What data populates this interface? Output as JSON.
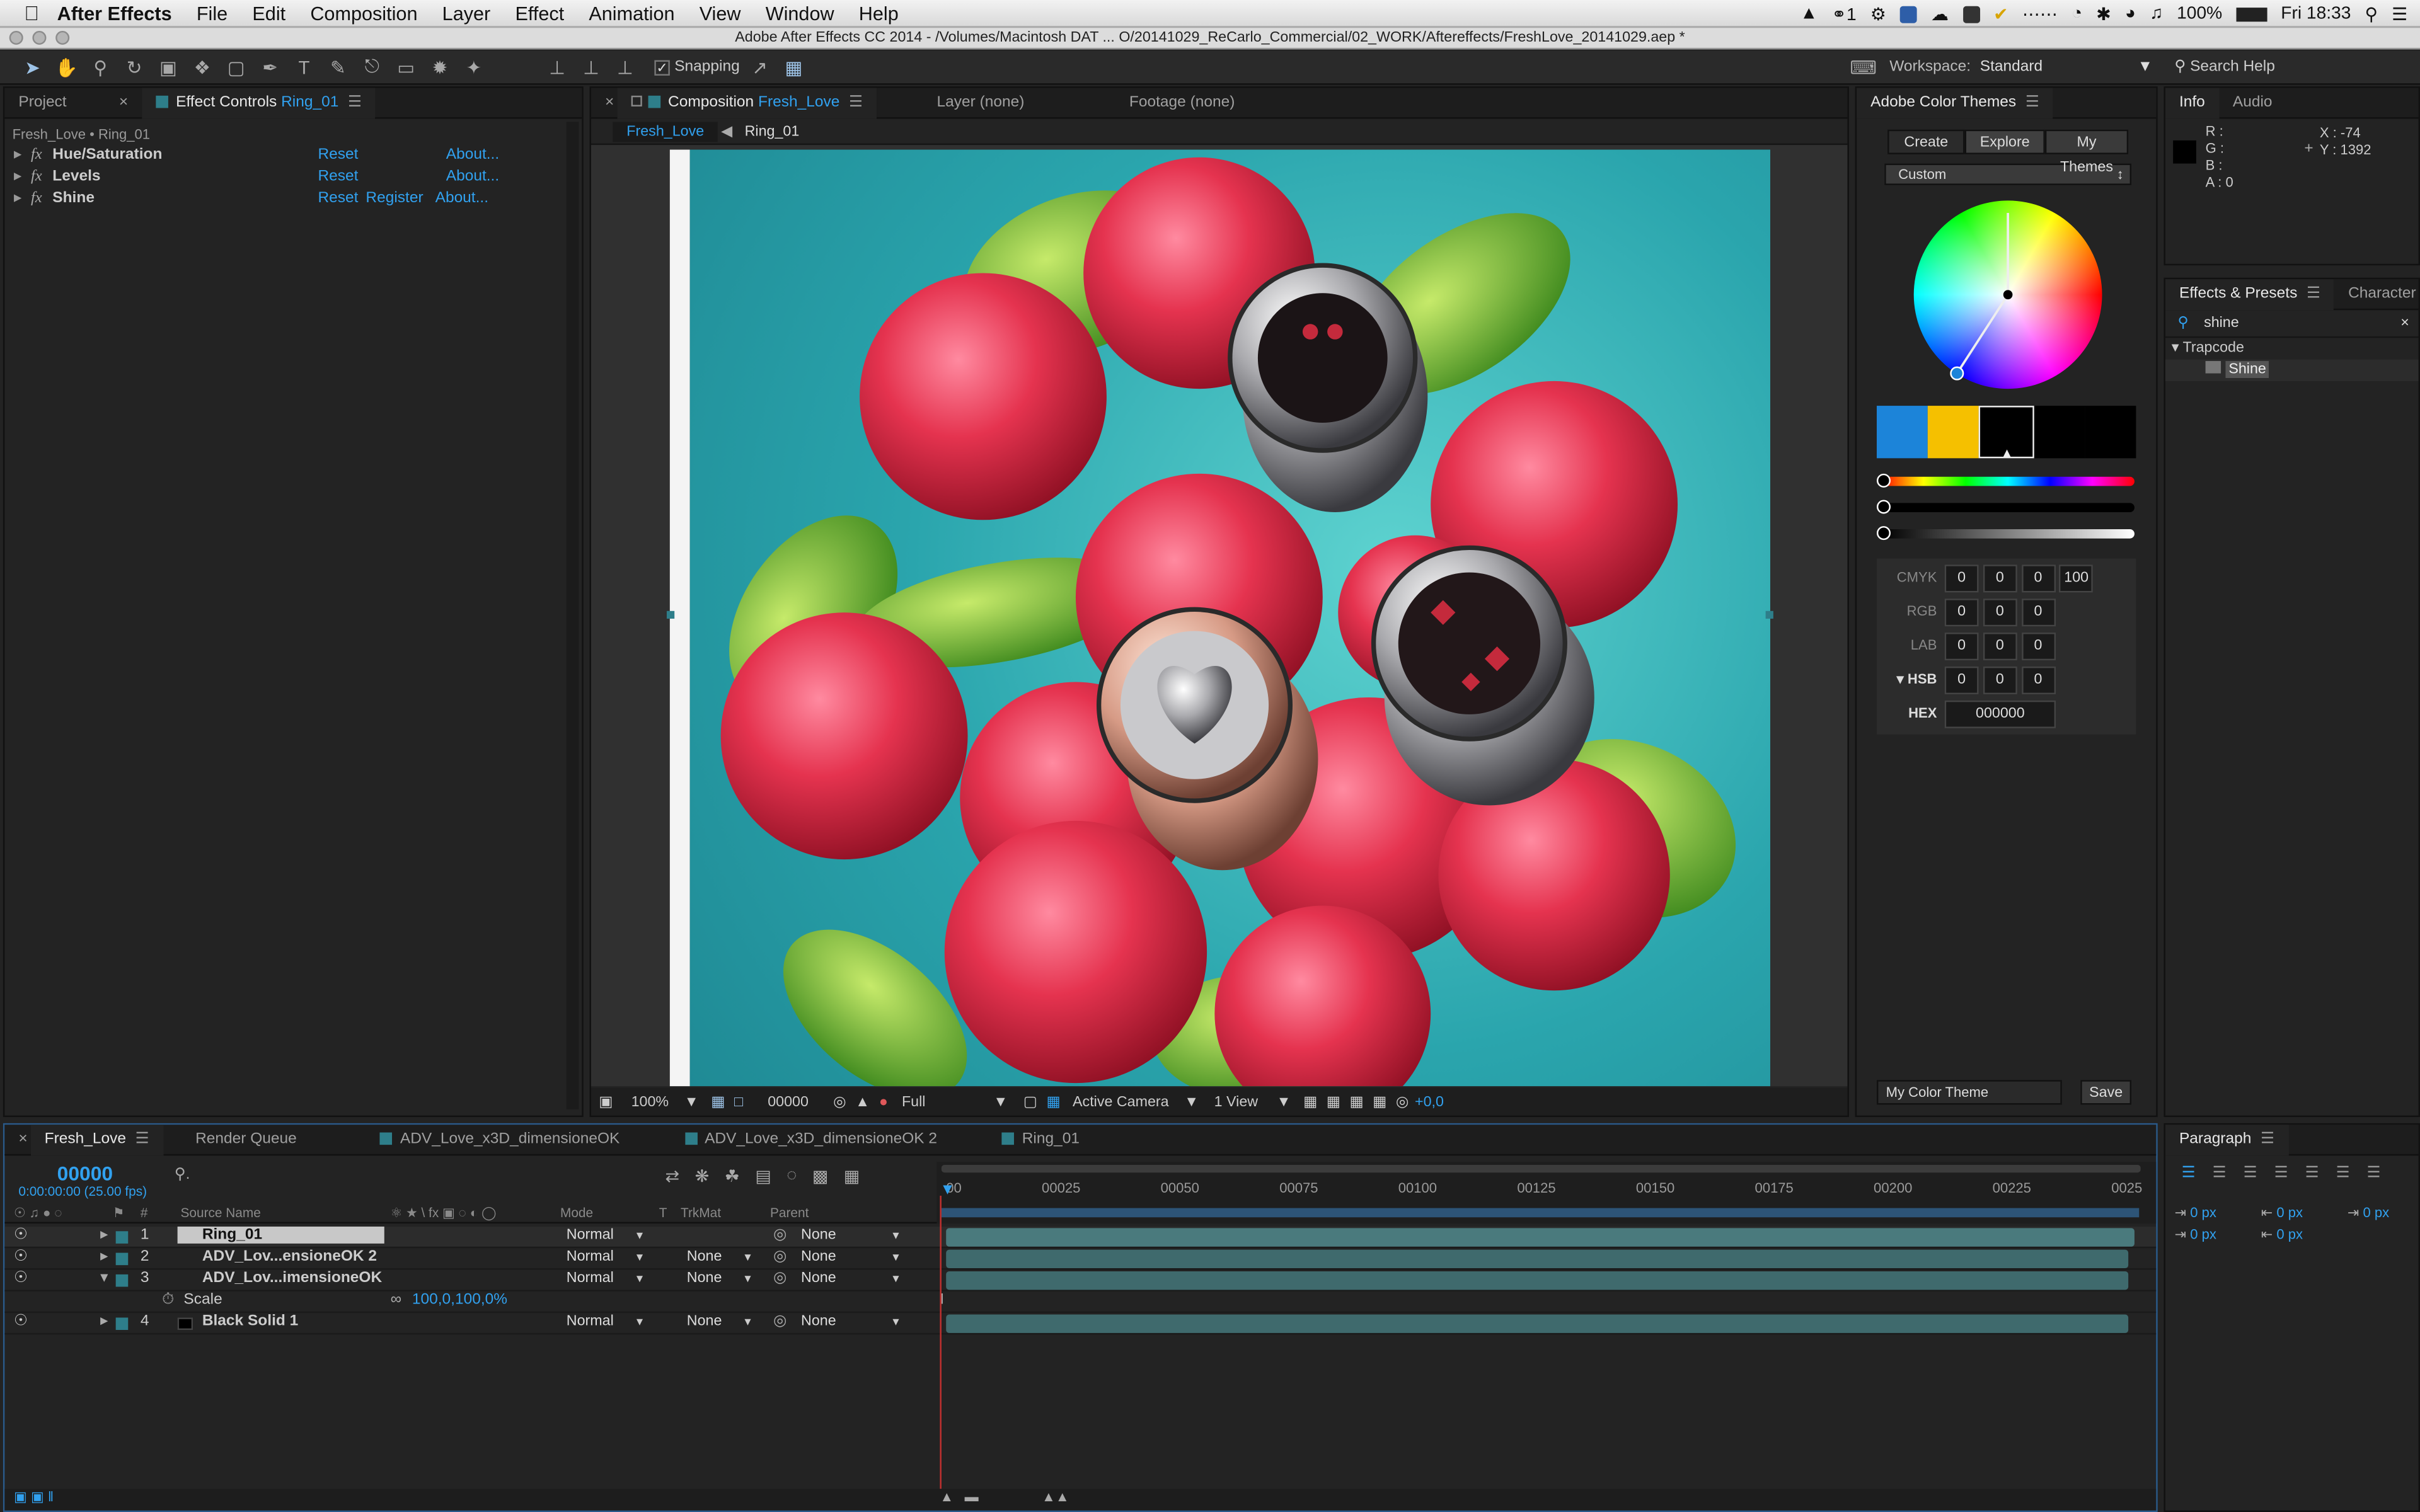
{
  "menubar": {
    "app": "After Effects",
    "items": [
      "File",
      "Edit",
      "Composition",
      "Layer",
      "Effect",
      "Animation",
      "View",
      "Window",
      "Help"
    ],
    "battery": "100%",
    "clock": "Fri 18:33",
    "notification_count": "1"
  },
  "window_title": "Adobe After Effects CC 2014 - /Volumes/Macintosh DAT ... O/20141029_ReCarlo_Commercial/02_WORK/Aftereffects/FreshLove_20141029.aep *",
  "toolbar": {
    "snapping": "Snapping",
    "workspace_label": "Workspace:",
    "workspace_value": "Standard",
    "search": "Search Help"
  },
  "project_panel": {
    "tab_project": "Project",
    "tab_effects": "Effect Controls",
    "layer": "Ring_01",
    "breadcrumb": "Fresh_Love • Ring_01",
    "effects": [
      {
        "name": "Hue/Saturation",
        "reset": "Reset",
        "register": "",
        "about": "About..."
      },
      {
        "name": "Levels",
        "reset": "Reset",
        "register": "",
        "about": "About..."
      },
      {
        "name": "Shine",
        "reset": "Reset",
        "register": "Register",
        "about": "About..."
      }
    ]
  },
  "comp_panel": {
    "tab": "Composition",
    "comp_name": "Fresh_Love",
    "layer_tab": "Layer (none)",
    "footage_tab": "Footage (none)",
    "crumb1": "Fresh_Love",
    "crumb2": "Ring_01",
    "zoom": "100%",
    "timecode": "00000",
    "resolution": "Full",
    "camera": "Active Camera",
    "views": "1 View",
    "exposure": "+0,0"
  },
  "color_themes": {
    "title": "Adobe Color Themes",
    "tabs": [
      "Create",
      "Explore",
      "My Themes"
    ],
    "preset": "Custom",
    "swatches": [
      "#1c84d9",
      "#f5c000",
      "#000000",
      "#000000",
      "#000000"
    ],
    "cmyk_label": "CMYK",
    "cmyk": [
      "0",
      "0",
      "0",
      "100"
    ],
    "rgb_label": "RGB",
    "rgb": [
      "0",
      "0",
      "0"
    ],
    "lab_label": "LAB",
    "lab": [
      "0",
      "0",
      "0"
    ],
    "hsb_label": "HSB",
    "hsb": [
      "0",
      "0",
      "0"
    ],
    "hex_label": "HEX",
    "hex": "000000",
    "theme_name": "My Color Theme",
    "save": "Save"
  },
  "info": {
    "tab": "Info",
    "tab2": "Audio",
    "r": "R :",
    "g": "G :",
    "b": "B :",
    "a": "A : 0",
    "x": "X : -74",
    "y": "Y : 1392"
  },
  "effects_presets": {
    "tab": "Effects & Presets",
    "tab2": "Character",
    "search": "shine",
    "group": "Trapcode",
    "item": "Shine"
  },
  "paragraph": {
    "tab": "Paragraph",
    "values": [
      "0 px",
      "0 px",
      "0 px",
      "0 px",
      "0 px"
    ]
  },
  "timeline": {
    "tabs": [
      "Fresh_Love",
      "Render Queue",
      "ADV_Love_x3D_dimensioneOK",
      "ADV_Love_x3D_dimensioneOK 2",
      "Ring_01"
    ],
    "timecode": "00000",
    "timecode_sub": "0:00:00:00 (25.00 fps)",
    "col_source": "Source Name",
    "col_mode": "Mode",
    "col_t": "T",
    "col_trkmat": "TrkMat",
    "col_parent": "Parent",
    "ruler": [
      "00",
      "00025",
      "00050",
      "00075",
      "00100",
      "00125",
      "00150",
      "00175",
      "00200",
      "00225",
      "0025"
    ],
    "layers": [
      {
        "num": "1",
        "name": "Ring_01",
        "mode": "Normal",
        "trkmat": "",
        "parent": "None"
      },
      {
        "num": "2",
        "name": "ADV_Lov...ensioneOK 2",
        "mode": "Normal",
        "trkmat": "None",
        "parent": "None"
      },
      {
        "num": "3",
        "name": "ADV_Lov...imensioneOK",
        "mode": "Normal",
        "trkmat": "None",
        "parent": "None"
      },
      {
        "num": "4",
        "name": "Black Solid 1",
        "mode": "Normal",
        "trkmat": "None",
        "parent": "None"
      }
    ],
    "scale_label": "Scale",
    "scale_value": "100,0,100,0%"
  }
}
